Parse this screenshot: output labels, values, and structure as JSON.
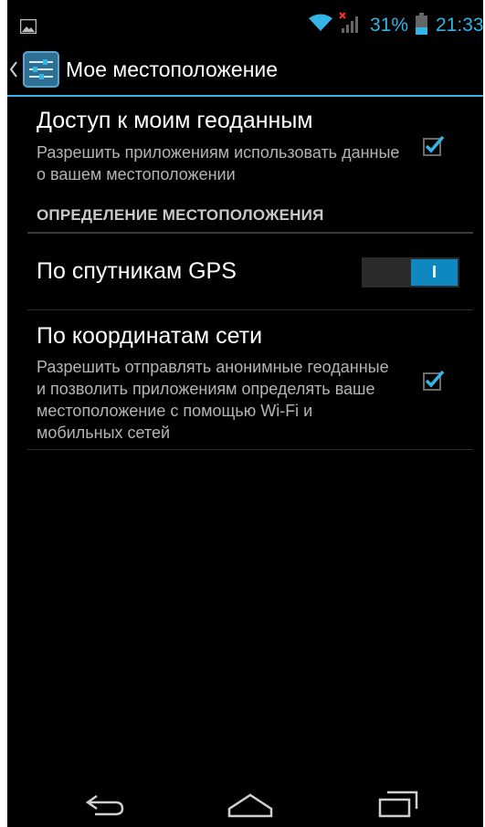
{
  "status_bar": {
    "battery": "31%",
    "time": "21:33",
    "icons": [
      "gallery-icon",
      "wifi-icon",
      "signal-no-sim-icon",
      "battery-icon"
    ],
    "accent_color": "#33b5e5"
  },
  "action_bar": {
    "title": "Мое местоположение",
    "icons": [
      "up-chevron-icon",
      "settings-sliders-icon"
    ]
  },
  "preferences": {
    "geo_access": {
      "title": "Доступ к моим геоданным",
      "summary": "Разрешить приложениям использовать данные о вашем местоположении",
      "checked": true
    },
    "category": "ОПРЕДЕЛЕНИЕ МЕСТОПОЛОЖЕНИЯ",
    "gps": {
      "title": "По спутникам GPS",
      "switch_label": "I",
      "on": true
    },
    "network": {
      "title": "По координатам сети",
      "summary": "Разрешить отправлять анонимные геоданные и позволить приложениям определять ваше местоположение с помощью Wi-Fi и мобильных сетей",
      "checked": true
    }
  },
  "nav_bar": {
    "icons": [
      "back-icon",
      "home-icon",
      "recent-apps-icon"
    ]
  }
}
